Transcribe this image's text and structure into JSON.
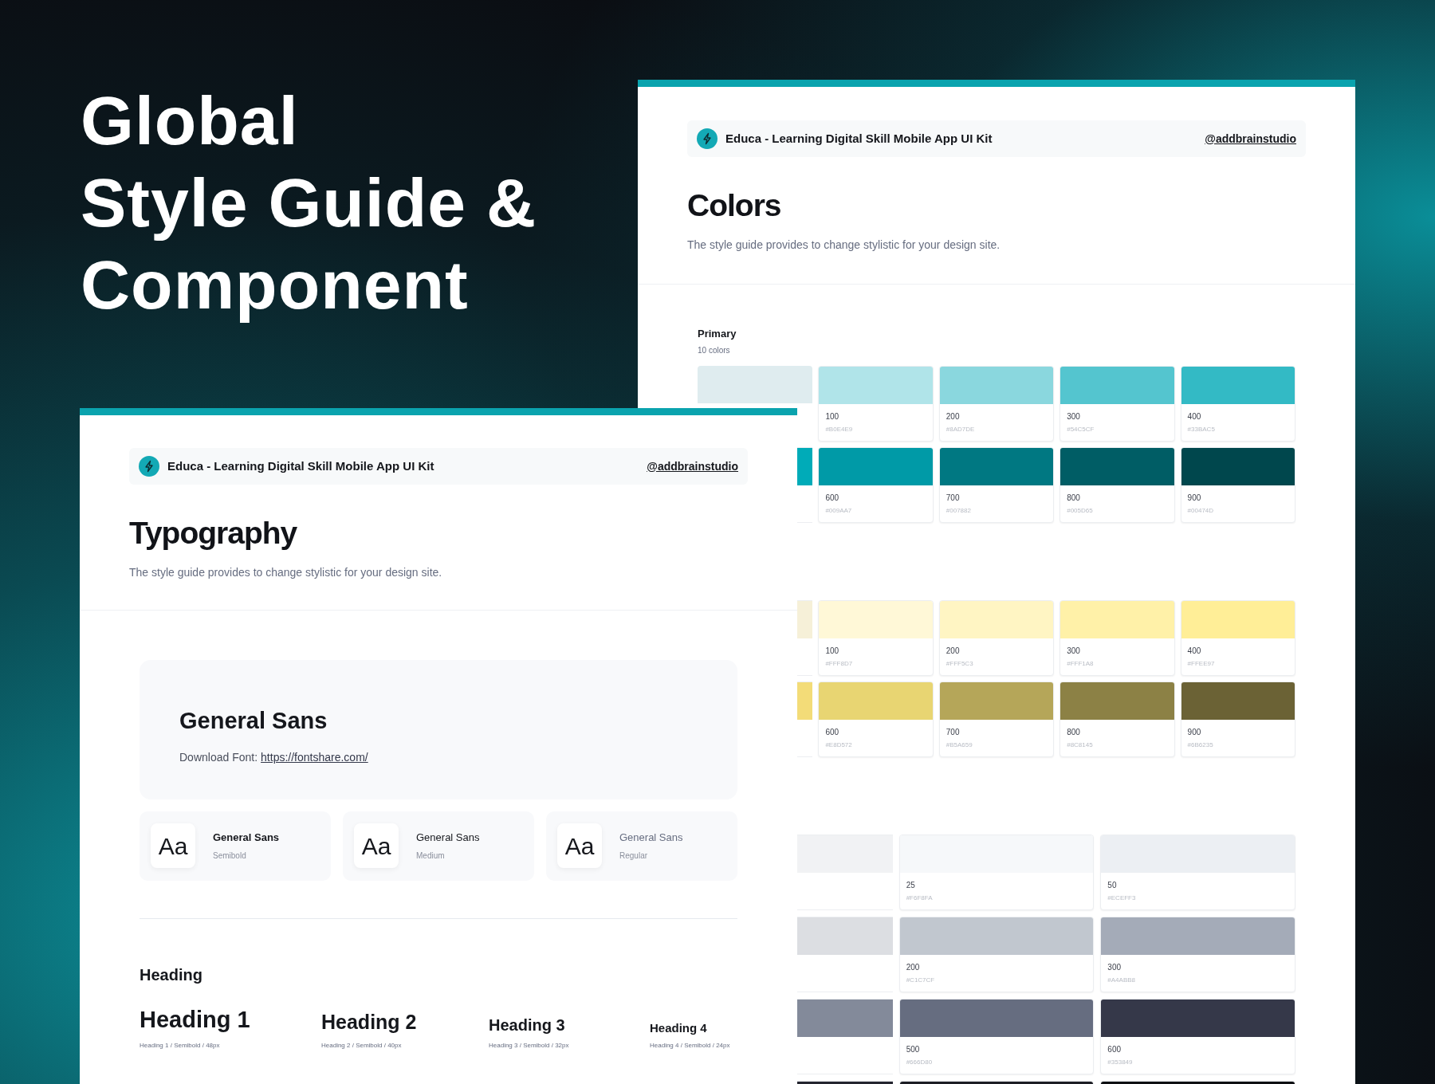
{
  "headline": [
    "Global",
    "Style Guide &",
    "Component"
  ],
  "colors_page": {
    "header": {
      "title": "Educa - Learning Digital Skill Mobile App UI Kit",
      "handle": "@addbrainstudio"
    },
    "title": "Colors",
    "subtitle": "The style guide provides to change stylistic for your design site.",
    "groups": [
      {
        "kind": "five",
        "name": "Primary",
        "count": "10 colors",
        "swatches": [
          {
            "kind": "top-part",
            "color": "#dfecef"
          },
          {
            "label": "100",
            "code": "#B0E4E9",
            "color": "#b0e4e9"
          },
          {
            "label": "200",
            "code": "#8AD7DE",
            "color": "#8ad7de"
          },
          {
            "label": "300",
            "code": "#54C5CF",
            "color": "#54c5cf"
          },
          {
            "label": "400",
            "code": "#33BAC5",
            "color": "#33bac5"
          },
          {
            "kind": "edge-part",
            "color": "#00abb8"
          },
          {
            "label": "600",
            "code": "#009AA7",
            "color": "#009aa7"
          },
          {
            "label": "700",
            "code": "#007882",
            "color": "#007882"
          },
          {
            "label": "800",
            "code": "#005D65",
            "color": "#005d65"
          },
          {
            "label": "900",
            "code": "#00474D",
            "color": "#00474d"
          }
        ]
      },
      {
        "kind": "five",
        "swatches": [
          {
            "kind": "edge-part",
            "color": "#f6f0d8"
          },
          {
            "label": "100",
            "code": "#FFF8D7",
            "color": "#fff8d7"
          },
          {
            "label": "200",
            "code": "#FFF5C3",
            "color": "#fff5c3"
          },
          {
            "label": "300",
            "code": "#FFF1A8",
            "color": "#fff1a8"
          },
          {
            "label": "400",
            "code": "#FFEE97",
            "color": "#ffee97"
          },
          {
            "kind": "edge-part",
            "color": "#f3dc78"
          },
          {
            "label": "600",
            "code": "#E8D572",
            "color": "#e8d572"
          },
          {
            "label": "700",
            "code": "#B5A659",
            "color": "#b5a659"
          },
          {
            "label": "800",
            "code": "#8C8145",
            "color": "#8c8145"
          },
          {
            "label": "900",
            "code": "#6B6235",
            "color": "#6b6235"
          }
        ]
      },
      {
        "kind": "three",
        "swatches": [
          {
            "kind": "edge-part",
            "color": "#f1f2f4"
          },
          {
            "label": "25",
            "code": "#F6F8FA",
            "color": "#f6f8fa"
          },
          {
            "label": "50",
            "code": "#ECEFF3",
            "color": "#eceff3"
          },
          {
            "kind": "edge-part",
            "color": "#dcdee2"
          },
          {
            "label": "200",
            "code": "#C1C7CF",
            "color": "#c1c7cf"
          },
          {
            "label": "300",
            "code": "#A4ABB8",
            "color": "#a4abb8"
          },
          {
            "kind": "edge-part",
            "color": "#838a9a"
          },
          {
            "label": "500",
            "code": "#666D80",
            "color": "#666d80"
          },
          {
            "label": "600",
            "code": "#353849",
            "color": "#353849"
          },
          {
            "kind": "edge-part",
            "color": "#24252f"
          },
          {
            "color": "#1c1d24"
          },
          {
            "color": "#0e0f12"
          }
        ]
      }
    ]
  },
  "typography_page": {
    "header": {
      "title": "Educa - Learning Digital Skill Mobile App UI Kit",
      "handle": "@addbrainstudio"
    },
    "title": "Typography",
    "subtitle": "The style guide provides to change stylistic for your design site.",
    "font": {
      "name": "General Sans",
      "download_label": "Download Font:",
      "download_link": "https://fontshare.com/"
    },
    "weights": [
      {
        "sample": "Aa",
        "name": "General Sans",
        "weight": "Semibold",
        "kind": "semibold"
      },
      {
        "sample": "Aa",
        "name": "General Sans",
        "weight": "Medium",
        "kind": "medium"
      },
      {
        "sample": "Aa",
        "name": "General Sans",
        "weight": "Regular",
        "kind": "regular"
      }
    ],
    "heading_section": "Heading",
    "headings": [
      {
        "kind": "h1",
        "text": "Heading 1",
        "spec": "Heading 1 / Semibold / 48px"
      },
      {
        "kind": "h2",
        "text": "Heading 2",
        "spec": "Heading 2 / Semibold / 40px"
      },
      {
        "kind": "h3",
        "text": "Heading 3",
        "spec": "Heading 3 / Semibold / 32px"
      },
      {
        "kind": "h4",
        "text": "Heading 4",
        "spec": "Heading 4 / Semibold / 24px"
      }
    ]
  }
}
